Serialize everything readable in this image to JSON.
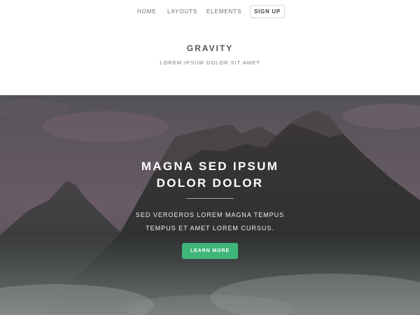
{
  "nav": {
    "links": [
      {
        "label": "HOME"
      },
      {
        "label": "LAYOUTS"
      },
      {
        "label": "ELEMENTS"
      }
    ],
    "signup_label": "SIGN UP"
  },
  "header": {
    "title": "GRAVITY",
    "tagline": "LOREM IPSUM DOLOR SIT AMET"
  },
  "hero": {
    "heading_lines": [
      "MAGNA SED IPSUM",
      "DOLOR DOLOR"
    ],
    "text_lines": [
      "SED VEROEROS LOREM MAGNA TEMPUS",
      "TEMPUS ET AMET LOREM CURSUS."
    ],
    "button_label": "LEARN MORE",
    "background_icon": "mountain-landscape-image"
  },
  "colors": {
    "accent": "#3fb57a",
    "title": "#555555",
    "nav_text": "#6e6e6e"
  }
}
